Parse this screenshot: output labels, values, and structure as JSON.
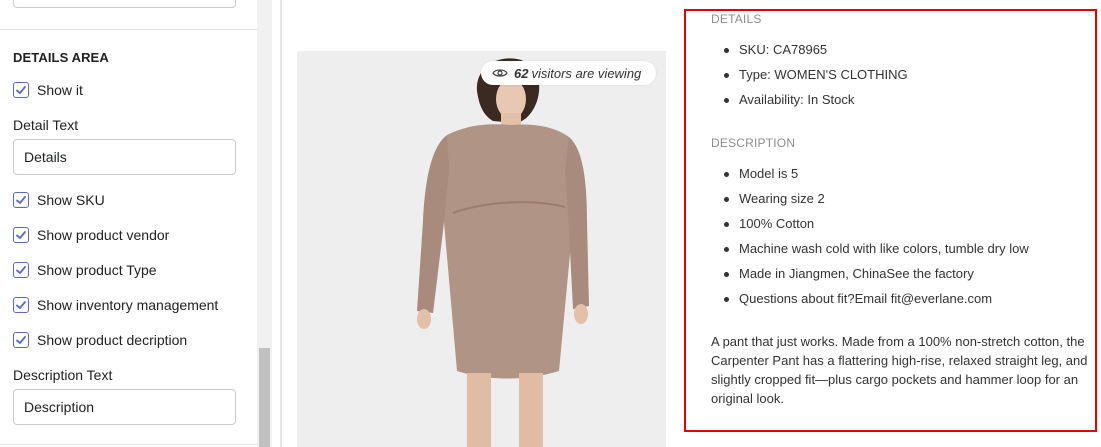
{
  "settings": {
    "section_title": "DETAILS AREA",
    "show_it": "Show it",
    "detail_text_label": "Detail Text",
    "detail_text_value": "Details",
    "show_sku": "Show SKU",
    "show_vendor": "Show product vendor",
    "show_type": "Show product Type",
    "show_inventory": "Show inventory management",
    "show_description": "Show product decription",
    "description_text_label": "Description Text",
    "description_text_value": "Description"
  },
  "preview": {
    "visitors_count": "62",
    "visitors_text": "visitors are viewing",
    "details_heading": "DETAILS",
    "details": [
      "SKU: CA78965",
      "Type: WOMEN'S CLOTHING",
      "Availability: In Stock"
    ],
    "description_heading": "DESCRIPTION",
    "description_items": [
      "Model is 5",
      "Wearing size 2",
      "100% Cotton",
      "Machine wash cold with like colors, tumble dry low",
      "Made in Jiangmen, ChinaSee the factory",
      "Questions about fit?Email fit@everlane.com"
    ],
    "description_paragraph": "A pant that just works. Made from a 100% non-stretch cotton, the Carpenter Pant has a flattering high-rise, relaxed straight leg, and slightly cropped fit—plus cargo pockets and hammer loop for an original look."
  },
  "colors": {
    "checkbox_accent": "#5c6ac4",
    "highlight_border": "#e20000"
  }
}
